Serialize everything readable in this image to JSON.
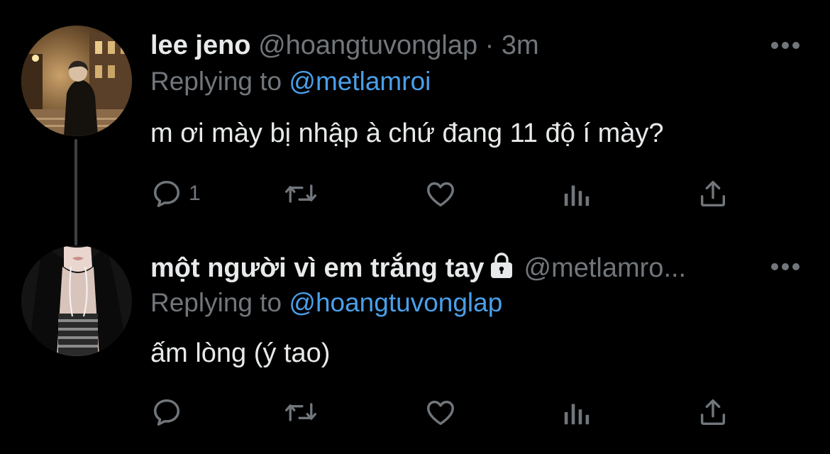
{
  "colors": {
    "background": "#000000",
    "primary_text": "#e7e9ea",
    "secondary_text": "#71767b",
    "mention": "#4a9fea",
    "thread_line": "#3e4144"
  },
  "tweets": [
    {
      "display_name": "lee jeno",
      "handle": "@hoangtuvonglap",
      "separator": "·",
      "time": "3m",
      "replying_prefix": "Replying to",
      "replying_to": "@metlamroi",
      "text": "m ơi mày bị nhập à chứ đang 11 độ í mày?",
      "reply_count": "1",
      "icons": [
        "reply-icon",
        "retweet-icon",
        "like-icon",
        "views-icon",
        "share-icon",
        "more-icon"
      ]
    },
    {
      "display_name": "một người vì em trắng tay",
      "handle": "@metlamro...",
      "protected_icon": "lock-icon",
      "replying_prefix": "Replying to",
      "replying_to": "@hoangtuvonglap",
      "text": "ấm lòng (ý tao)",
      "reply_count": "",
      "icons": [
        "reply-icon",
        "retweet-icon",
        "like-icon",
        "views-icon",
        "share-icon",
        "more-icon"
      ]
    }
  ]
}
